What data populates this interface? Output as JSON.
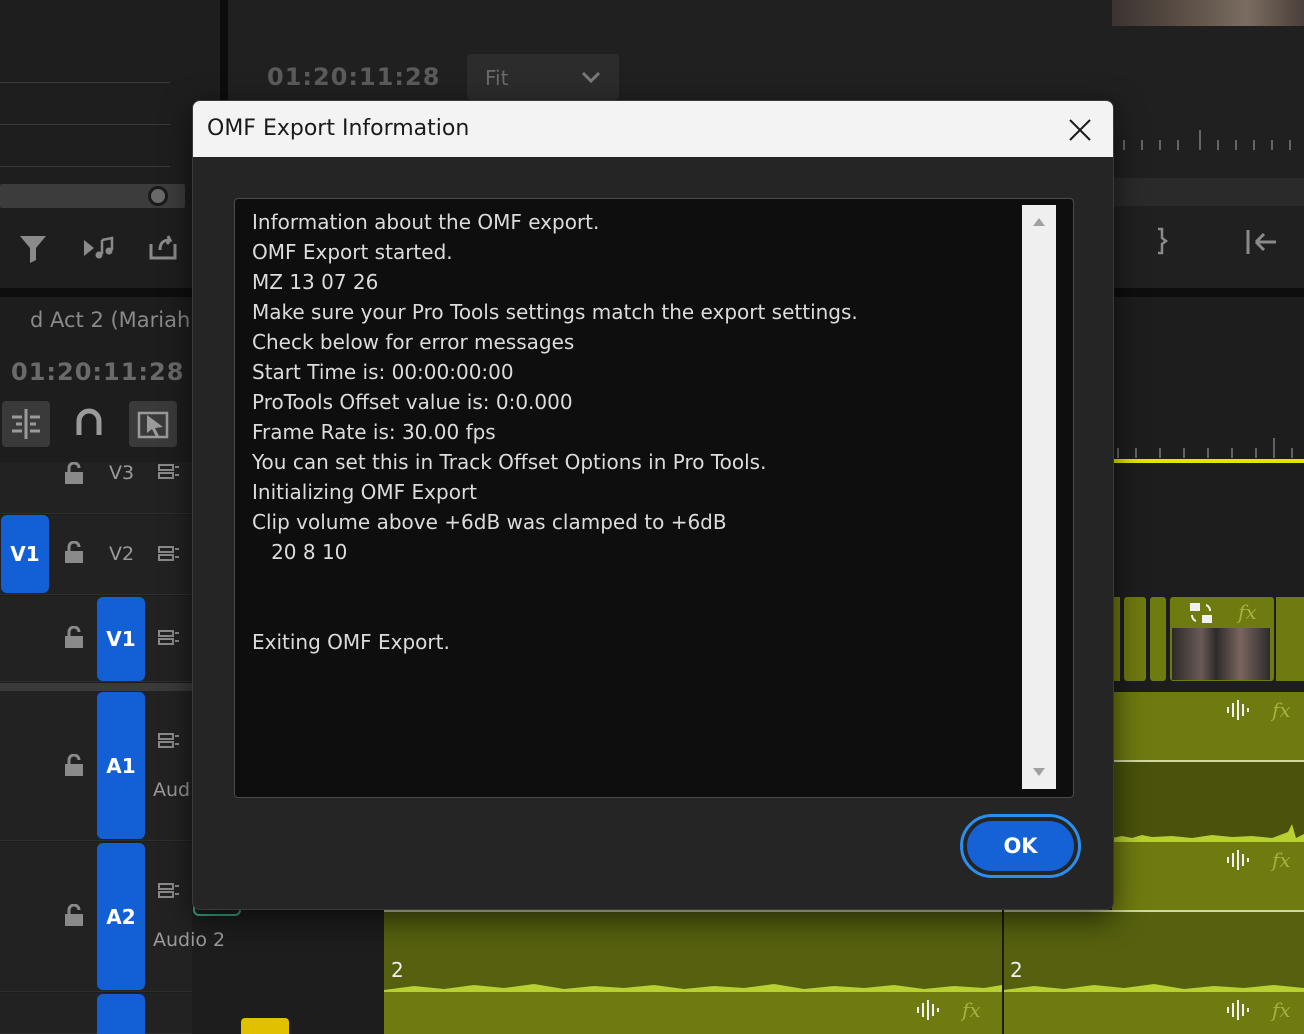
{
  "source_panel": {
    "timecode": "01:20:11:28"
  },
  "program_panel": {
    "timecode": "01:20:11:28",
    "zoom_select": "Fit"
  },
  "timeline": {
    "sequence_name": "d Act 2 (Mariah)",
    "timecode": "01:20:11:28",
    "tracks": {
      "v3": "V3",
      "v2": "V2",
      "v1_source": "V1",
      "v1": "V1",
      "a1": "A1",
      "a1_name": "Aud",
      "a2": "A2",
      "a2_name": "Audio 2"
    },
    "clip_labels": [
      "2",
      "2"
    ],
    "fx_label": "fx"
  },
  "dialog": {
    "title": "OMF Export Information",
    "log_lines": [
      "Information about the OMF export.",
      "OMF Export started.",
      "MZ 13 07 26",
      "Make sure your Pro Tools settings match the export settings.",
      "Check below for error messages",
      "Start Time is: 00:00:00:00",
      "ProTools Offset value is: 0:0.000",
      "Frame Rate is: 30.00 fps",
      "You can set this in Track Offset Options in Pro Tools.",
      "Initializing OMF Export",
      "Clip volume above +6dB was clamped to +6dB",
      "   20 8 10",
      "",
      "",
      "Exiting OMF Export."
    ],
    "ok_label": "OK"
  },
  "colors": {
    "accent": "#1462d6",
    "clip_green": "#6f7a10",
    "playhead_yellow": "#e4e400"
  }
}
